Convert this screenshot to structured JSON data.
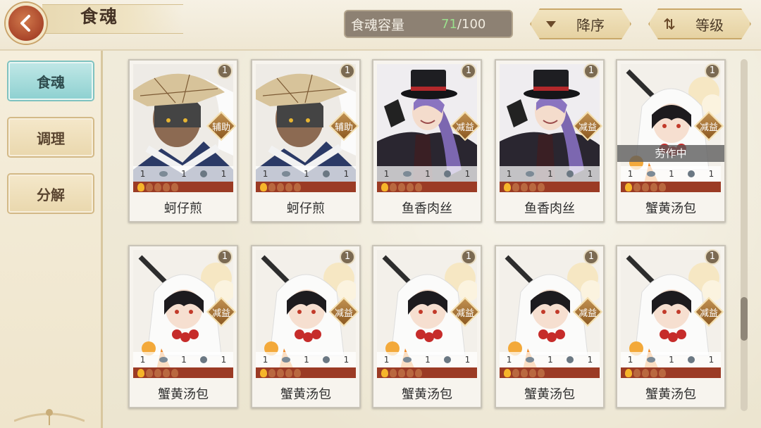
{
  "header": {
    "title": "食魂",
    "capacity_label": "食魂容量",
    "capacity_current": "71",
    "capacity_separator": "/",
    "capacity_max": "100",
    "sort_order_label": "降序",
    "sort_by_label": "等级"
  },
  "sidebar": {
    "items": [
      {
        "label": "食魂",
        "active": true
      },
      {
        "label": "调理",
        "active": false
      },
      {
        "label": "分解",
        "active": false
      }
    ]
  },
  "cards": [
    {
      "name": "蚵仔煎",
      "level": "1",
      "role": "辅助",
      "stats": [
        "1",
        "1",
        "1"
      ],
      "stars_lit": 1,
      "status": "",
      "theme": "strawhat"
    },
    {
      "name": "蚵仔煎",
      "level": "1",
      "role": "辅助",
      "stats": [
        "1",
        "1",
        "1"
      ],
      "stars_lit": 1,
      "status": "",
      "theme": "strawhat"
    },
    {
      "name": "鱼香肉丝",
      "level": "1",
      "role": "减益",
      "stats": [
        "1",
        "1",
        "1"
      ],
      "stars_lit": 1,
      "status": "",
      "theme": "tophat"
    },
    {
      "name": "鱼香肉丝",
      "level": "1",
      "role": "减益",
      "stats": [
        "1",
        "1",
        "1"
      ],
      "stars_lit": 1,
      "status": "",
      "theme": "tophat"
    },
    {
      "name": "蟹黄汤包",
      "level": "1",
      "role": "减益",
      "stats": [
        "1",
        "1",
        "1"
      ],
      "stars_lit": 1,
      "status": "劳作中",
      "theme": "hood"
    },
    {
      "name": "蟹黄汤包",
      "level": "1",
      "role": "减益",
      "stats": [
        "1",
        "1",
        "1"
      ],
      "stars_lit": 1,
      "status": "",
      "theme": "hood"
    },
    {
      "name": "蟹黄汤包",
      "level": "1",
      "role": "减益",
      "stats": [
        "1",
        "1",
        "1"
      ],
      "stars_lit": 1,
      "status": "",
      "theme": "hood"
    },
    {
      "name": "蟹黄汤包",
      "level": "1",
      "role": "减益",
      "stats": [
        "1",
        "1",
        "1"
      ],
      "stars_lit": 1,
      "status": "",
      "theme": "hood"
    },
    {
      "name": "蟹黄汤包",
      "level": "1",
      "role": "减益",
      "stats": [
        "1",
        "1",
        "1"
      ],
      "stars_lit": 1,
      "status": "",
      "theme": "hood"
    },
    {
      "name": "蟹黄汤包",
      "level": "1",
      "role": "减益",
      "stats": [
        "1",
        "1",
        "1"
      ],
      "stars_lit": 1,
      "status": "",
      "theme": "hood"
    }
  ]
}
